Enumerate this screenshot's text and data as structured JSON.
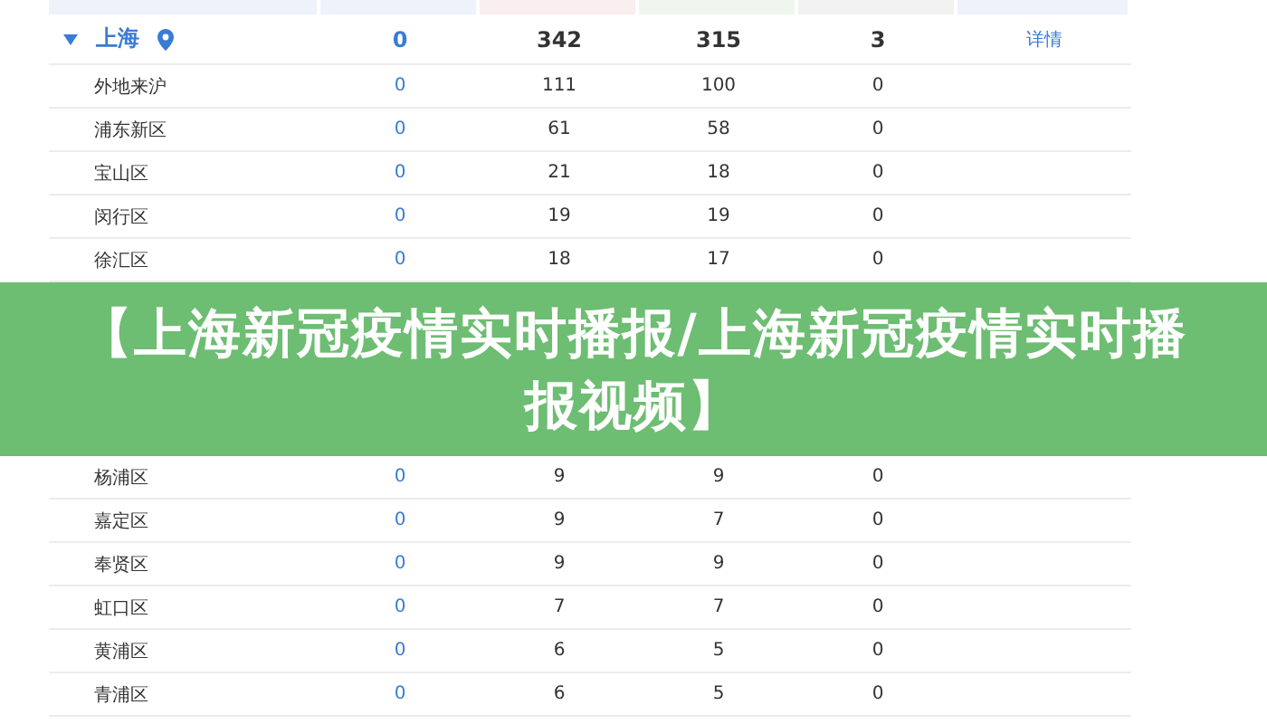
{
  "total": {
    "name": "上海",
    "expanded": true,
    "cells": [
      "0",
      "342",
      "315",
      "3"
    ],
    "link": "详情"
  },
  "rows": [
    {
      "name": "外地来沪",
      "cells": [
        "0",
        "111",
        "100",
        "0"
      ]
    },
    {
      "name": "浦东新区",
      "cells": [
        "0",
        "61",
        "58",
        "0"
      ]
    },
    {
      "name": "宝山区",
      "cells": [
        "0",
        "21",
        "18",
        "0"
      ]
    },
    {
      "name": "闵行区",
      "cells": [
        "0",
        "19",
        "19",
        "0"
      ]
    },
    {
      "name": "徐汇区",
      "cells": [
        "0",
        "18",
        "17",
        "0"
      ]
    }
  ],
  "banner": {
    "title": "【上海新冠疫情实时播报/上海新冠疫情实时播报视频】"
  },
  "rows_below_banner": [
    {
      "name": "杨浦区",
      "cells": [
        "0",
        "9",
        "9",
        "0"
      ]
    },
    {
      "name": "嘉定区",
      "cells": [
        "0",
        "9",
        "7",
        "0"
      ]
    },
    {
      "name": "奉贤区",
      "cells": [
        "0",
        "9",
        "9",
        "0"
      ]
    },
    {
      "name": "虹口区",
      "cells": [
        "0",
        "7",
        "7",
        "0"
      ]
    },
    {
      "name": "黄浦区",
      "cells": [
        "0",
        "6",
        "5",
        "0"
      ]
    },
    {
      "name": "青浦区",
      "cells": [
        "0",
        "6",
        "5",
        "0"
      ]
    }
  ]
}
